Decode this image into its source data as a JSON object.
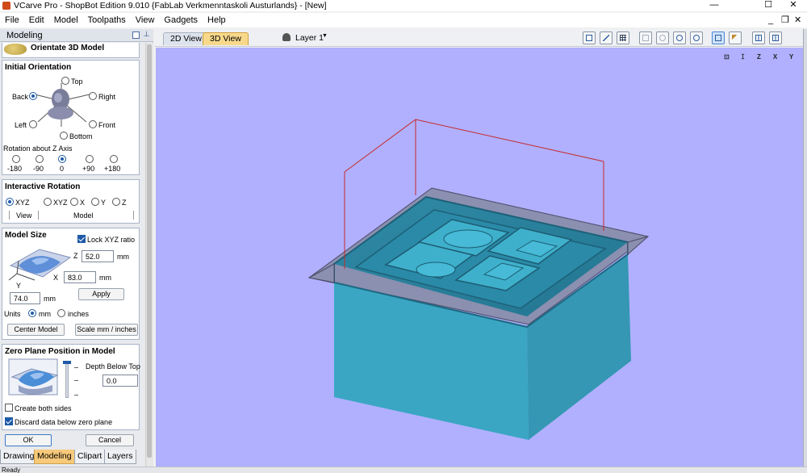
{
  "window": {
    "title": "VCarve Pro - ShopBot Edition 9.010 {FabLab Verkmenntaskoli Austurlands} - [New]",
    "controls": [
      "—",
      "☐",
      "✕"
    ]
  },
  "menu": {
    "items": [
      "File",
      "Edit",
      "Model",
      "Toolpaths",
      "View",
      "Gadgets",
      "Help"
    ],
    "mdi_controls": [
      "_",
      "❐",
      "✕"
    ]
  },
  "panel": {
    "title": "Modeling",
    "subtitle": "Orientate 3D Model",
    "orientation": {
      "heading": "Initial Orientation",
      "top": "Top",
      "back": "Back",
      "right": "Right",
      "left": "Left",
      "front": "Front",
      "bottom": "Bottom",
      "selected": "Back",
      "rotation_label": "Rotation about Z Axis",
      "rotation_options": [
        "-180",
        "-90",
        "0",
        "+90",
        "+180"
      ],
      "rotation_selected": "0"
    },
    "interactive": {
      "heading": "Interactive Rotation",
      "options": [
        "XYZ",
        "XYZ",
        "X",
        "Y",
        "Z"
      ],
      "selected_index": 0,
      "view_label": "View",
      "model_label": "Model"
    },
    "model_size": {
      "heading": "Model Size",
      "lock_label": "Lock XYZ ratio",
      "lock_checked": true,
      "z_label": "Z",
      "z_value": "52.0",
      "z_unit": "mm",
      "x_label": "X",
      "x_value": "83.0",
      "x_unit": "mm",
      "y_label": "Y",
      "y_value": "74.0",
      "y_unit": "mm",
      "apply": "Apply",
      "units_label": "Units",
      "unit_mm": "mm",
      "unit_inches": "inches",
      "unit_selected": "mm",
      "center_model": "Center Model",
      "scale": "Scale mm / inches"
    },
    "zero_plane": {
      "heading": "Zero Plane Position in Model",
      "depth_label": "Depth Below Top",
      "depth_value": "0.0",
      "create_both": "Create both sides",
      "create_both_checked": false,
      "discard": "Discard data below zero plane",
      "discard_checked": true
    },
    "ok": "OK",
    "cancel": "Cancel",
    "tabs": [
      "Drawing",
      "Modeling",
      "Clipart",
      "Layers"
    ],
    "active_tab": "Modeling"
  },
  "view": {
    "tabs": [
      "2D View",
      "3D View"
    ],
    "active_tab": "3D View",
    "layer": "Layer 1",
    "viewport_icons": [
      "⊡",
      "ꕯ",
      "Z",
      "X",
      "Y"
    ],
    "colors": {
      "background": "#b0b0ff",
      "model": "#3aa6c3",
      "bbox": "#c82828",
      "zero_plane": "#8b8fb0"
    }
  },
  "status": {
    "text": "Ready"
  }
}
